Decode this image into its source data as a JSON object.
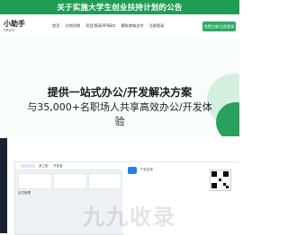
{
  "banner": {
    "text": "关于实施大学生创业扶持计划的公告"
  },
  "header": {
    "logo_text": "小助手",
    "logo_sub": "tdturn",
    "nav_items": [
      {
        "label": "首页"
      },
      {
        "label": "分销兑换"
      },
      {
        "label": "项目/报表API接口"
      },
      {
        "label": "模拟商城支付"
      },
      {
        "label": "注册登录"
      }
    ],
    "cta_label": "免费注册/立即登录"
  },
  "hero": {
    "title": "提供一站式办公/开发解决方案",
    "subtitle": "与35,000+名职场人共享高效办公/开发体验"
  },
  "preview": {
    "app_tab_1": "某工程",
    "app_tab_2": "开发者",
    "app_label": "会员管理",
    "app_name": "产品名称"
  },
  "watermark": {
    "text": "九九收录"
  },
  "colors": {
    "brand_green": "#2faa63",
    "banner_green": "#1f9d55",
    "dark_sidebar": "#1b2230"
  },
  "icons": [
    "logo-mark",
    "app-icon",
    "qr-code"
  ]
}
